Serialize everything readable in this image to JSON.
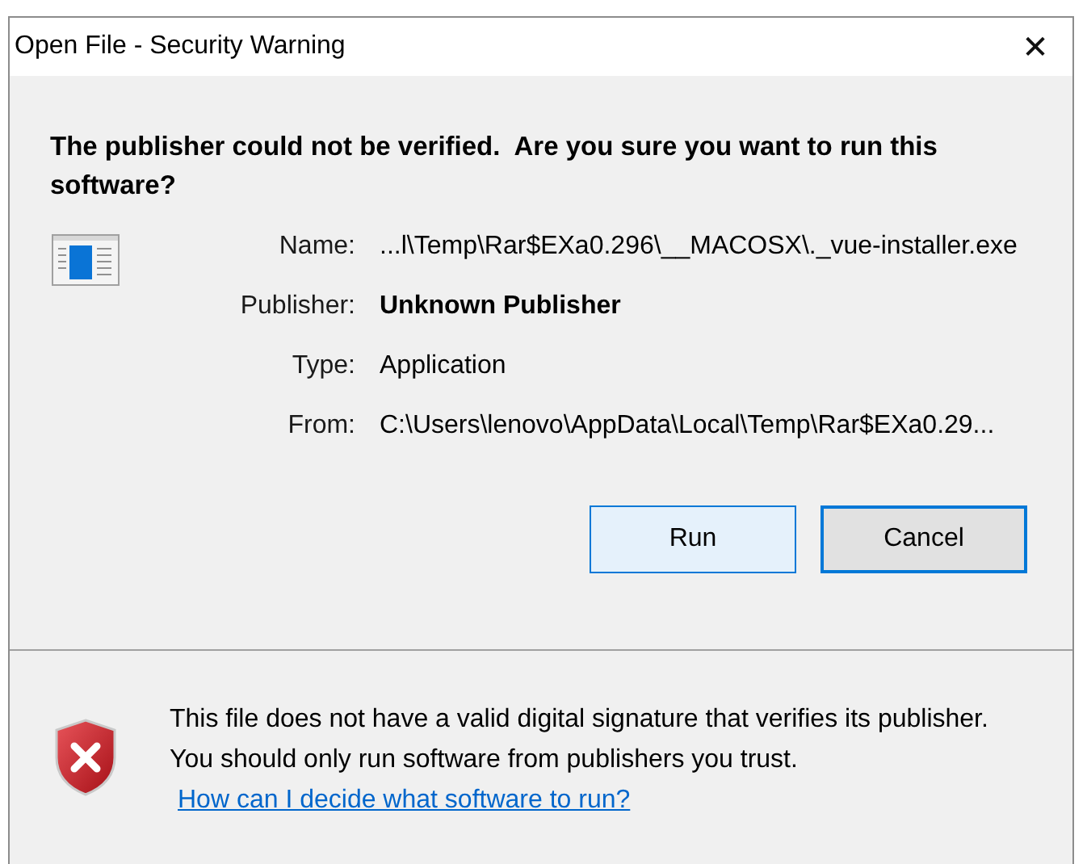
{
  "window": {
    "title": "Open File - Security Warning",
    "close": "✕"
  },
  "heading": "The publisher could not be verified.  Are you sure you want to run this software?",
  "fields": [
    {
      "label": "Name:",
      "value": "...l\\Temp\\Rar$EXa0.296\\__MACOSX\\._vue-installer.exe",
      "bold": false
    },
    {
      "label": "Publisher:",
      "value": "Unknown Publisher",
      "bold": true
    },
    {
      "label": "Type:",
      "value": "Application",
      "bold": false
    },
    {
      "label": "From:",
      "value": "C:\\Users\\lenovo\\AppData\\Local\\Temp\\Rar$EXa0.29...",
      "bold": false
    }
  ],
  "buttons": [
    {
      "label": "Run",
      "kind": "default"
    },
    {
      "label": "Cancel",
      "kind": "focused"
    }
  ],
  "warning": {
    "text": "This file does not have a valid digital signature that verifies its publisher.  You should only run software from publishers you trust.",
    "link": "How can I decide what software to run?"
  }
}
